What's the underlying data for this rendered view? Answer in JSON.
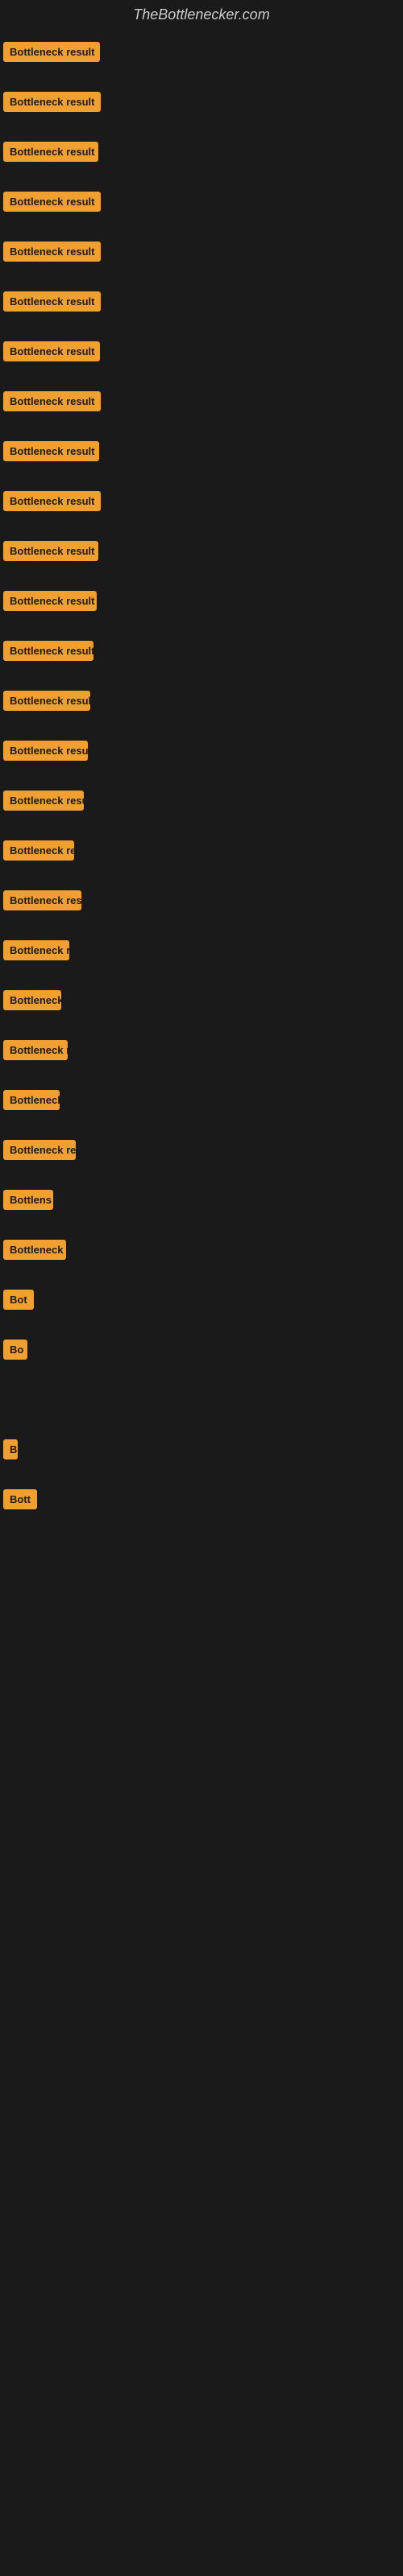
{
  "site": {
    "title": "TheBottlenecker.com"
  },
  "rows": [
    {
      "label": "Bottleneck result",
      "width": 120
    },
    {
      "label": "Bottleneck result",
      "width": 130
    },
    {
      "label": "Bottleneck result",
      "width": 118
    },
    {
      "label": "Bottleneck result",
      "width": 122
    },
    {
      "label": "Bottleneck result",
      "width": 125
    },
    {
      "label": "Bottleneck result",
      "width": 128
    },
    {
      "label": "Bottleneck result",
      "width": 120
    },
    {
      "label": "Bottleneck result",
      "width": 122
    },
    {
      "label": "Bottleneck result",
      "width": 119
    },
    {
      "label": "Bottleneck result",
      "width": 121
    },
    {
      "label": "Bottleneck result",
      "width": 118
    },
    {
      "label": "Bottleneck result",
      "width": 116
    },
    {
      "label": "Bottleneck result",
      "width": 112
    },
    {
      "label": "Bottleneck result",
      "width": 108
    },
    {
      "label": "Bottleneck result",
      "width": 105
    },
    {
      "label": "Bottleneck result",
      "width": 100
    },
    {
      "label": "Bottleneck re",
      "width": 88
    },
    {
      "label": "Bottleneck result",
      "width": 97
    },
    {
      "label": "Bottleneck r",
      "width": 82
    },
    {
      "label": "Bottleneck",
      "width": 72
    },
    {
      "label": "Bottleneck r",
      "width": 80
    },
    {
      "label": "Bottleneck",
      "width": 70
    },
    {
      "label": "Bottleneck res",
      "width": 90
    },
    {
      "label": "Bottlens",
      "width": 62
    },
    {
      "label": "Bottleneck r",
      "width": 78
    },
    {
      "label": "Bot",
      "width": 38
    },
    {
      "label": "Bo",
      "width": 30
    },
    {
      "label": "",
      "width": 0
    },
    {
      "label": "B",
      "width": 18
    },
    {
      "label": "Bott",
      "width": 42
    },
    {
      "label": "",
      "width": 0
    },
    {
      "label": "",
      "width": 0
    },
    {
      "label": "",
      "width": 0
    },
    {
      "label": "",
      "width": 0
    },
    {
      "label": "",
      "width": 0
    },
    {
      "label": "",
      "width": 0
    },
    {
      "label": "",
      "width": 0
    },
    {
      "label": "",
      "width": 0
    },
    {
      "label": "",
      "width": 0
    },
    {
      "label": "",
      "width": 0
    },
    {
      "label": "",
      "width": 0
    },
    {
      "label": "",
      "width": 0
    }
  ]
}
